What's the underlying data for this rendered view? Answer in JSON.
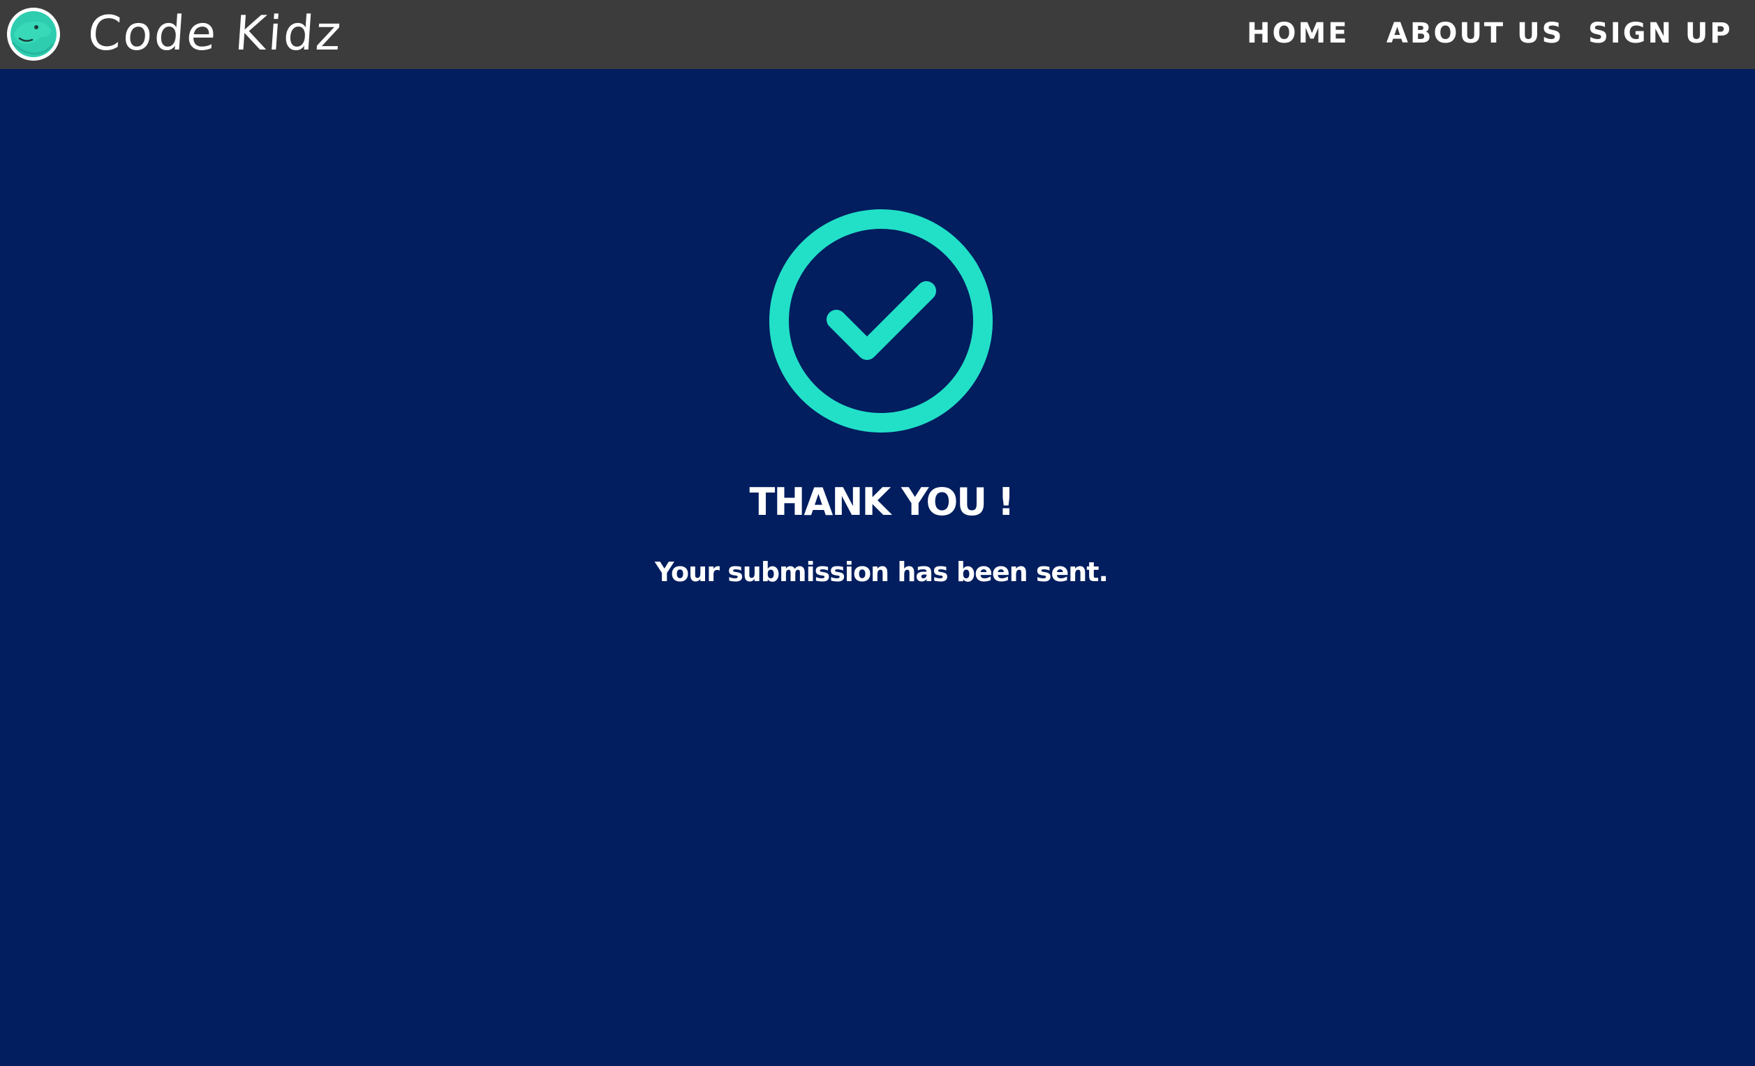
{
  "header": {
    "brand": "Code Kidz",
    "logo_icon": "dino-face-icon",
    "nav": {
      "home": "HOME",
      "about": "ABOUT US",
      "signup": "SIGN UP"
    }
  },
  "main": {
    "status_icon": "check-circle-icon",
    "title": "THANK YOU !",
    "message": "Your submission has been sent."
  },
  "colors": {
    "background": "#021e5f",
    "navbar": "#3c3c3c",
    "accent": "#22e0c8",
    "text": "#ffffff"
  }
}
